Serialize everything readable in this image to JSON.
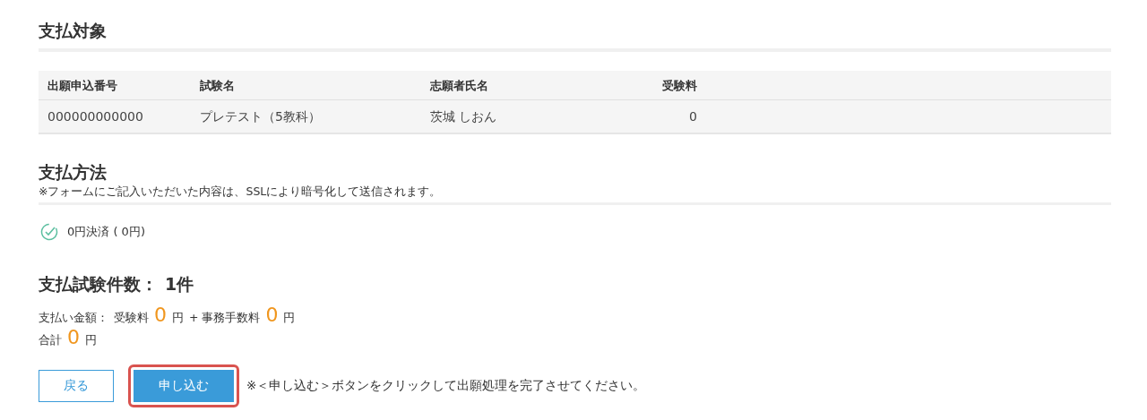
{
  "target": {
    "title": "支払対象",
    "columns": [
      "出願申込番号",
      "試験名",
      "志願者氏名",
      "受験料"
    ],
    "rows": [
      [
        "000000000000",
        "プレテスト（5教科）",
        "茨城 しおん",
        "0"
      ]
    ]
  },
  "method": {
    "title": "支払方法",
    "note": "※フォームにご記入いただいた内容は、SSLにより暗号化して送信されます。",
    "options": [
      {
        "label": "0円決済 ( 0円)",
        "checked": true
      }
    ]
  },
  "summary": {
    "count_label": "支払試験件数：",
    "count": "1件",
    "amount_label": "支払い金額：",
    "fee_label": "受験料",
    "fee": "0",
    "yen_1": "円",
    "plus_label": "+ 事務手数料",
    "handling": "0",
    "yen_2": "円",
    "total_label": "合計",
    "total": "0",
    "yen_3": "円"
  },
  "actions": {
    "back": "戻る",
    "submit": {
      "label": "申し込む",
      "highlighted": true
    },
    "note": "※＜申し込む＞ボタンをクリックして出願処理を完了させてください。"
  }
}
